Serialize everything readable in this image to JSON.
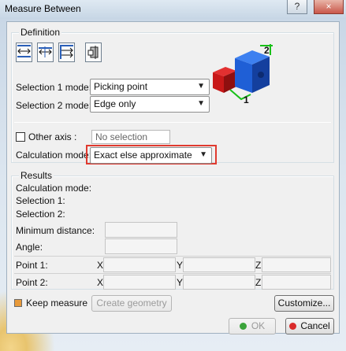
{
  "window": {
    "title": "Measure Between",
    "help_glyph": "?",
    "close_glyph": "×"
  },
  "definition": {
    "label": "Definition",
    "tool_icons": [
      "measure-between-icon",
      "measure-between-chained-icon",
      "measure-between-fan-icon",
      "measure-item-icon"
    ],
    "selection1_label": "Selection 1 mode:",
    "selection1_value": "Picking point",
    "selection2_label": "Selection 2 mode:",
    "selection2_value": "Edge only",
    "other_axis_label": "Other axis :",
    "other_axis_checked": false,
    "other_axis_value": "No selection",
    "calc_mode_label": "Calculation mode:",
    "calc_mode_value": "Exact else approximate",
    "preview_label_1": "1",
    "preview_label_2": "2"
  },
  "results": {
    "label": "Results",
    "calc_mode_label": "Calculation mode:",
    "selection1_label": "Selection 1:",
    "selection2_label": "Selection 2:",
    "min_distance_label": "Minimum distance:",
    "angle_label": "Angle:",
    "point1_label": "Point 1:",
    "point2_label": "Point 2:",
    "x_label": "X",
    "y_label": "Y",
    "z_label": "Z"
  },
  "footer": {
    "keep_measure_label": "Keep measure",
    "keep_measure_checked": true,
    "create_geometry_label": "Create geometry",
    "customize_label": "Customize...",
    "ok_label": "OK",
    "cancel_label": "Cancel"
  },
  "colors": {
    "highlight": "#e03a2f",
    "cube_blue": "#1f5fd6",
    "cube_red": "#d21e1e",
    "dimension_green": "#18c018"
  }
}
